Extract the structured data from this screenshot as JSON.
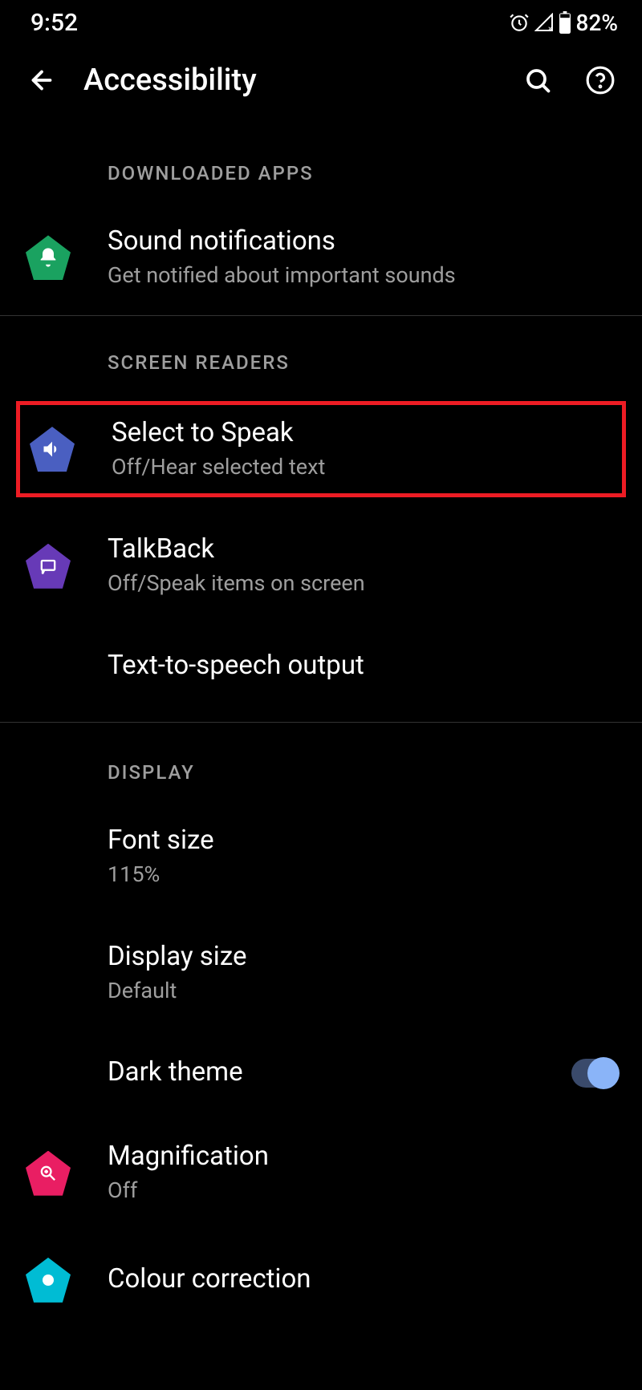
{
  "status_bar": {
    "time": "9:52",
    "battery_text": "82%"
  },
  "app_bar": {
    "title": "Accessibility"
  },
  "sections": {
    "downloaded_apps": {
      "header": "DOWNLOADED APPS",
      "sound_notifications": {
        "title": "Sound notifications",
        "sub": "Get notified about important sounds"
      }
    },
    "screen_readers": {
      "header": "SCREEN READERS",
      "select_to_speak": {
        "title": "Select to Speak",
        "sub": "Off/Hear selected text"
      },
      "talkback": {
        "title": "TalkBack",
        "sub": "Off/Speak items on screen"
      },
      "tts": {
        "title": "Text-to-speech output"
      }
    },
    "display": {
      "header": "DISPLAY",
      "font_size": {
        "title": "Font size",
        "sub": "115%"
      },
      "display_size": {
        "title": "Display size",
        "sub": "Default"
      },
      "dark_theme": {
        "title": "Dark theme",
        "state": true
      },
      "magnification": {
        "title": "Magnification",
        "sub": "Off"
      },
      "colour_correction": {
        "title": "Colour correction"
      }
    }
  }
}
